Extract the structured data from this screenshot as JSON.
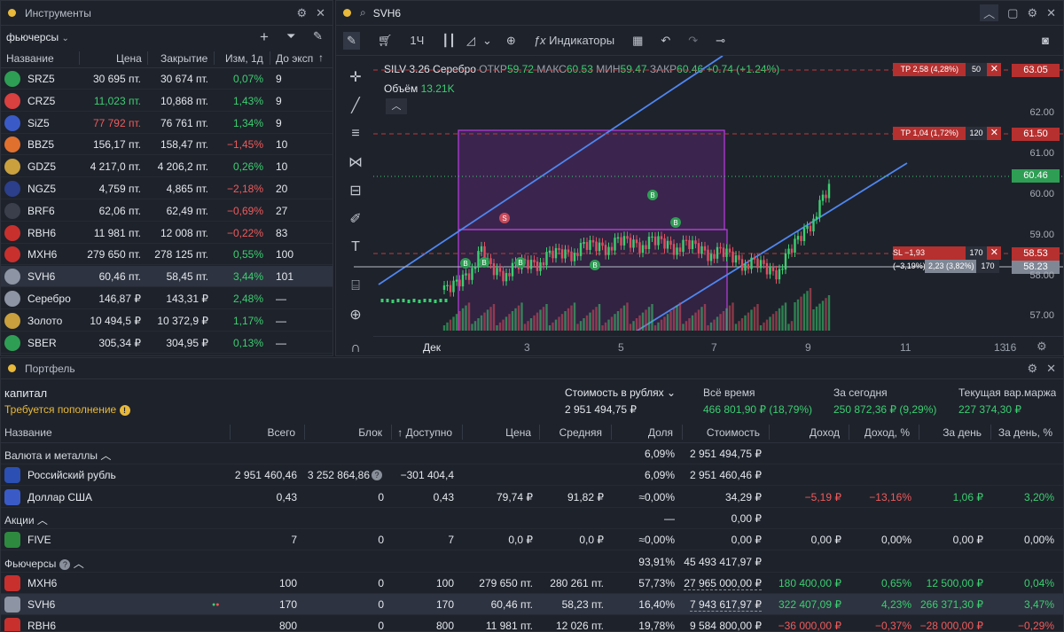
{
  "instruments": {
    "title": "Инструменты",
    "filter": "фьючерсы",
    "columns": [
      "Название",
      "Цена",
      "Закрытие",
      "Изм, 1д",
      "До эксп"
    ],
    "rows": [
      {
        "name": "SRZ5",
        "price": "30 695 пт.",
        "close": "30 674 пт.",
        "chg": "0,07%",
        "exp": "9",
        "pc": "w",
        "cc": "g",
        "logo": "#2e9e54",
        "logo_icon": "sber-logo"
      },
      {
        "name": "CRZ5",
        "price": "11,023 пт.",
        "close": "10,868 пт.",
        "chg": "1,43%",
        "exp": "9",
        "pc": "g",
        "cc": "g",
        "logo": "#d94040",
        "logo_icon": "flag-cny-icon"
      },
      {
        "name": "SiZ5",
        "price": "77 792 пт.",
        "close": "76 761 пт.",
        "chg": "1,34%",
        "exp": "9",
        "pc": "r",
        "cc": "g",
        "logo": "#3a5bc7",
        "logo_icon": "flag-usd-icon"
      },
      {
        "name": "BBZ5",
        "price": "156,17 пт.",
        "close": "158,47 пт.",
        "chg": "−1,45%",
        "exp": "10",
        "pc": "w",
        "cc": "r",
        "logo": "#e0702e",
        "logo_icon": "brent-icon"
      },
      {
        "name": "GDZ5",
        "price": "4 217,0 пт.",
        "close": "4 206,2 пт.",
        "chg": "0,26%",
        "exp": "10",
        "pc": "w",
        "cc": "g",
        "logo": "#c9a03d",
        "logo_icon": "gold-icon"
      },
      {
        "name": "NGZ5",
        "price": "4,759 пт.",
        "close": "4,865 пт.",
        "chg": "−2,18%",
        "exp": "20",
        "pc": "w",
        "cc": "r",
        "logo": "#2b3f8a",
        "logo_icon": "gas-icon"
      },
      {
        "name": "BRF6",
        "price": "62,06 пт.",
        "close": "62,49 пт.",
        "chg": "−0,69%",
        "exp": "27",
        "pc": "w",
        "cc": "r",
        "logo": "#3a3f4b",
        "logo_icon": "oil-icon"
      },
      {
        "name": "RBH6",
        "price": "11 981 пт.",
        "close": "12 008 пт.",
        "chg": "−0,22%",
        "exp": "83",
        "pc": "w",
        "cc": "r",
        "logo": "#c8302e",
        "logo_icon": "rbh-icon"
      },
      {
        "name": "MXH6",
        "price": "279 650 пт.",
        "close": "278 125 пт.",
        "chg": "0,55%",
        "exp": "100",
        "pc": "w",
        "cc": "g",
        "logo": "#c8302e",
        "logo_icon": "moex-icon"
      },
      {
        "name": "SVH6",
        "price": "60,46 пт.",
        "close": "58,45 пт.",
        "chg": "3,44%",
        "exp": "101",
        "pc": "w",
        "cc": "g",
        "logo": "#8d94a3",
        "logo_icon": "silver-icon",
        "selected": true
      },
      {
        "name": "Серебро",
        "price": "146,87 ₽",
        "close": "143,31 ₽",
        "chg": "2,48%",
        "exp": "—",
        "pc": "w",
        "cc": "g",
        "logo": "#8d94a3",
        "logo_icon": "silver-icon"
      },
      {
        "name": "Золото",
        "price": "10 494,5 ₽",
        "close": "10 372,9 ₽",
        "chg": "1,17%",
        "exp": "—",
        "pc": "w",
        "cc": "g",
        "logo": "#c9a03d",
        "logo_icon": "gold-icon"
      },
      {
        "name": "SBER",
        "price": "305,34 ₽",
        "close": "304,95 ₽",
        "chg": "0,13%",
        "exp": "—",
        "pc": "w",
        "cc": "g",
        "logo": "#2e9e54",
        "logo_icon": "sber-logo"
      }
    ]
  },
  "chart": {
    "title": "SVH6",
    "timeframe": "1Ч",
    "indicators_label": "Индикаторы",
    "legend_name": "SILV-3.26 Серебро",
    "ohlc": {
      "o_label": "ОТКР",
      "o": "59.72",
      "h_label": "МАКС",
      "h": "60.53",
      "l_label": "МИН",
      "l": "59.47",
      "c_label": "ЗАКР",
      "c": "60.46",
      "chg": "+0.74 (+1.24%)"
    },
    "volume_label": "Объём",
    "volume": "13.21K",
    "x_ticks": [
      "Дек",
      "3",
      "5",
      "7",
      "9",
      "11",
      "13",
      "16"
    ],
    "y_ticks": [
      "63.05",
      "62.00",
      "61.50",
      "61.00",
      "60.46",
      "60.00",
      "59.00",
      "58.53",
      "58.23",
      "58.00",
      "57.00"
    ],
    "orders": [
      {
        "label": "TP 2,58 (4,28%)",
        "qty": "50",
        "price": "63.05"
      },
      {
        "label": "TP 1,04 (1,72%)",
        "qty": "120",
        "price": "61.50"
      },
      {
        "label": "SL −1,93 (−3,19%)",
        "qty": "170",
        "price": "58.53"
      }
    ],
    "position": {
      "label": "2,23 (3,82%)",
      "qty": "170",
      "price": "58.23"
    },
    "last_price": "60.46",
    "markers": [
      "S",
      "B",
      "B",
      "B",
      "B",
      "B",
      "B"
    ]
  },
  "portfolio": {
    "title": "Портфель",
    "account": "капитал",
    "warning": "Требуется пополнение",
    "summary": [
      {
        "label": "Стоимость в рублях",
        "value": "2 951 494,75 ₽",
        "color": "w"
      },
      {
        "label": "Всё время",
        "value": "466 801,90 ₽ (18,79%)",
        "color": "g"
      },
      {
        "label": "За сегодня",
        "value": "250 872,36 ₽ (9,29%)",
        "color": "g"
      },
      {
        "label": "Текущая вар.маржа",
        "value": "227 374,30 ₽",
        "color": "g"
      }
    ],
    "columns": [
      "Название",
      "Всего",
      "Блок",
      "Доступно",
      "Цена",
      "Средняя",
      "Доля",
      "Стоимость",
      "Доход",
      "Доход, %",
      "За день",
      "За день, %"
    ],
    "groups": {
      "currency": {
        "name": "Валюта и металлы",
        "share": "6,09%",
        "value": "2 951 494,75 ₽"
      },
      "stocks": {
        "name": "Акции",
        "share": "—",
        "value": "0,00 ₽"
      },
      "futures": {
        "name": "Фьючерсы",
        "share": "93,91%",
        "value": "45 493 417,97 ₽"
      }
    },
    "rows": {
      "rub": {
        "name": "Российский рубль",
        "total": "2 951 460,46",
        "block": "3 252 864,86",
        "avail": "−301 404,4",
        "price": "",
        "avg": "",
        "share": "6,09%",
        "value": "2 951 460,46 ₽",
        "inc": "",
        "incp": "",
        "day": "",
        "dayp": ""
      },
      "usd": {
        "name": "Доллар США",
        "total": "0,43",
        "block": "0",
        "avail": "0,43",
        "price": "79,74 ₽",
        "avg": "91,82 ₽",
        "share": "≈0,00%",
        "value": "34,29 ₽",
        "inc": "−5,19 ₽",
        "incp": "−13,16%",
        "day": "1,06 ₽",
        "dayp": "3,20%"
      },
      "five": {
        "name": "FIVE",
        "total": "7",
        "block": "0",
        "avail": "7",
        "price": "0,0 ₽",
        "avg": "0,0 ₽",
        "share": "≈0,00%",
        "value": "0,00 ₽",
        "inc": "0,00 ₽",
        "incp": "0,00%",
        "day": "0,00 ₽",
        "dayp": "0,00%"
      },
      "mxh6": {
        "name": "MXH6",
        "total": "100",
        "block": "0",
        "avail": "100",
        "price": "279 650 пт.",
        "avg": "280 261 пт.",
        "share": "57,73%",
        "value": "27 965 000,00 ₽",
        "inc": "180 400,00 ₽",
        "incp": "0,65%",
        "day": "12 500,00 ₽",
        "dayp": "0,04%"
      },
      "svh6": {
        "name": "SVH6",
        "total": "170",
        "block": "0",
        "avail": "170",
        "price": "60,46 пт.",
        "avg": "58,23 пт.",
        "share": "16,40%",
        "value": "7 943 617,97 ₽",
        "inc": "322 407,09 ₽",
        "incp": "4,23%",
        "day": "266 371,30 ₽",
        "dayp": "3,47%"
      },
      "rbh6": {
        "name": "RBH6",
        "total": "800",
        "block": "0",
        "avail": "800",
        "price": "11 981 пт.",
        "avg": "12 026 пт.",
        "share": "19,78%",
        "value": "9 584 800,00 ₽",
        "inc": "−36 000,00 ₽",
        "incp": "−0,37%",
        "day": "−28 000,00 ₽",
        "dayp": "−0,29%"
      }
    }
  }
}
